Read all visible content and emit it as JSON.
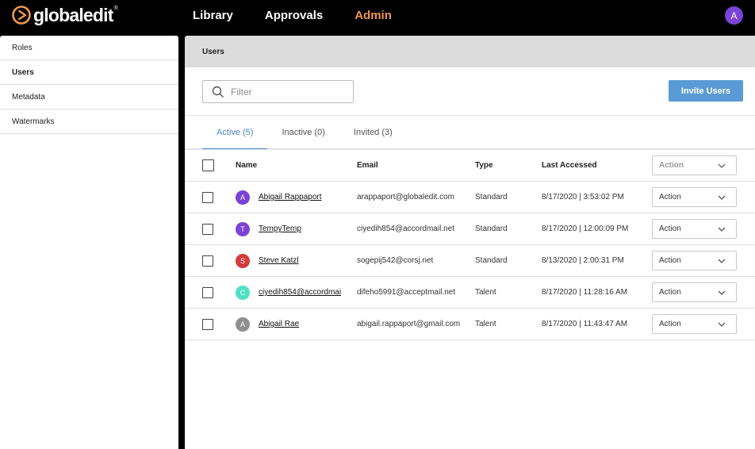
{
  "brand": {
    "name": "globaledit",
    "reg": "®",
    "accent": "#f0964e"
  },
  "topnav": [
    {
      "label": "Library",
      "active": false
    },
    {
      "label": "Approvals",
      "active": false
    },
    {
      "label": "Admin",
      "active": true
    }
  ],
  "user_avatar": {
    "initial": "A",
    "color": "#7b43d6"
  },
  "sidebar": {
    "items": [
      {
        "label": "Roles",
        "active": false
      },
      {
        "label": "Users",
        "active": true
      },
      {
        "label": "Metadata",
        "active": false
      },
      {
        "label": "Watermarks",
        "active": false
      }
    ]
  },
  "main": {
    "title": "Users",
    "filter": {
      "placeholder": "Filter",
      "value": ""
    },
    "invite_label": "Invite Users",
    "tabs": [
      {
        "label": "Active (5)",
        "active": true
      },
      {
        "label": "Inactive (0)",
        "active": false
      },
      {
        "label": "Invited (3)",
        "active": false
      }
    ],
    "table": {
      "columns": {
        "name": "Name",
        "email": "Email",
        "type": "Type",
        "last": "Last Accessed",
        "action": "Action"
      },
      "rows": [
        {
          "initial": "A",
          "color": "#7b43d6",
          "name": "Abigail Rappaport",
          "email": "arappaport@globaledit.com",
          "type": "Standard",
          "last": "8/17/2020 | 3:53:02 PM",
          "action": "Action"
        },
        {
          "initial": "T",
          "color": "#7b43d6",
          "name": "TempyTemp",
          "email": "ciyedih854@accordmail.net",
          "type": "Standard",
          "last": "8/17/2020 | 12:00:09 PM",
          "action": "Action"
        },
        {
          "initial": "S",
          "color": "#d63a3a",
          "name": "Steve Katzl",
          "email": "sogepij542@corsj.net",
          "type": "Standard",
          "last": "8/13/2020 | 2:00:31 PM",
          "action": "Action"
        },
        {
          "initial": "C",
          "color": "#4fe0c4",
          "name": "ciyedih854@accordmai",
          "email": "difeho5991@acceptmail.net",
          "type": "Talent",
          "last": "8/17/2020 | 11:28:16 AM",
          "action": "Action"
        },
        {
          "initial": "A",
          "color": "#8f8f8f",
          "name": "Abigail Rae",
          "email": "abigail.rappaport@gmail.com",
          "type": "Talent",
          "last": "8/17/2020 | 11:43:47 AM",
          "action": "Action"
        }
      ]
    }
  }
}
